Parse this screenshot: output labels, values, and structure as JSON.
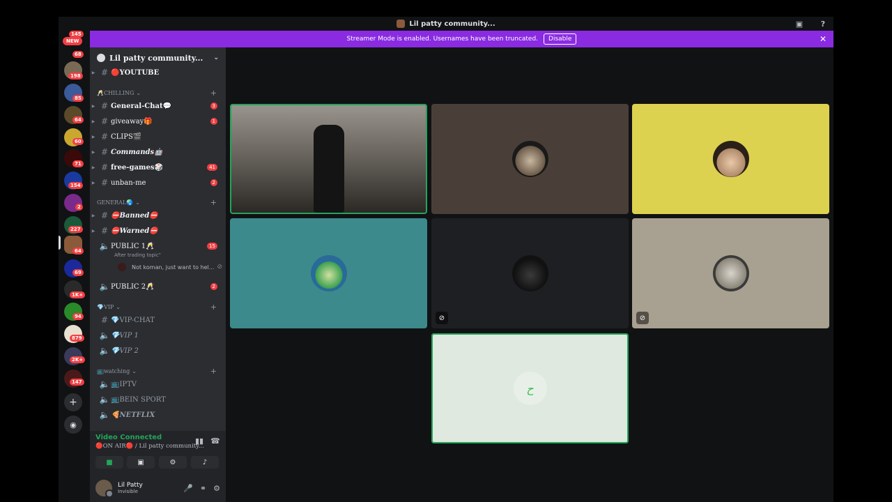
{
  "window": {
    "title": "Lil patty community..."
  },
  "banner": {
    "text": "Streamer Mode is enabled. Usernames have been truncated.",
    "button": "Disable"
  },
  "rail": {
    "new_badge": "NEW",
    "top_count": "145",
    "badges": [
      "68",
      "198",
      "85",
      "64",
      "60",
      "71",
      "154",
      "2",
      "227",
      "64",
      "69",
      "1K+",
      "94",
      "879",
      "2K+",
      "147"
    ]
  },
  "guild": {
    "name": "Lil patty community..."
  },
  "channels": {
    "youtube": "🔴YOUTUBE",
    "cat_chilling": "🥂CHILLING",
    "general_chat": "General-Chat💬",
    "general_chat_count": "3",
    "giveaway": "giveaway🎁",
    "giveaway_count": "1",
    "clips": "CLIPS🎬",
    "commands": "Commands🤖",
    "free_games": "free-games🎲",
    "free_games_count": "41",
    "unban": "unban-me",
    "unban_count": "2",
    "cat_general": "GENERAL🌏",
    "banned": "⛔Banned⛔",
    "warned": "⛔Warned⛔",
    "public1": "PUBLIC 1🥂",
    "public1_count": "15",
    "public1_topic": "After trading topic\"",
    "public1_member": "Not koman, just want to hel...",
    "public2": "PUBLIC 2🥂",
    "public2_count": "2",
    "cat_vip": "💎VIP",
    "vip_chat": "💎VIP-CHAT",
    "vip1": "💎VIP 1",
    "vip2": "💎VIP 2",
    "cat_watching": "📺watching",
    "iptv": "📺IPTV",
    "bein": "📺BEIN SPORT",
    "netflix": "🍕NETFLIX"
  },
  "voice": {
    "status": "Video Connected",
    "channel": "🔴ON AIR🔴 / Lil patty community..."
  },
  "user": {
    "name": "Lil Patty",
    "status": "Invisible"
  },
  "colors": {
    "banner": "#8a2be2",
    "speaking": "#23a55a",
    "badge": "#f23f43"
  }
}
